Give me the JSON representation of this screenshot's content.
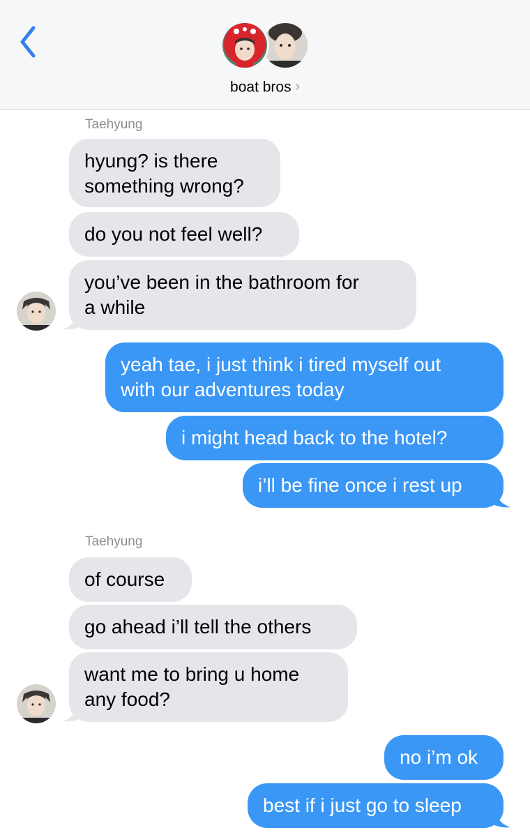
{
  "header": {
    "title": "boat bros",
    "chevron": "›"
  },
  "colors": {
    "sent_bubble": "#3a97f6",
    "received_bubble": "#e5e5ea",
    "ios_blue": "#2f80ed",
    "header_bg": "#f6f7f8"
  },
  "icons": [
    "back-chevron-icon",
    "group-avatar-red-hood",
    "group-avatar-portrait",
    "sender-avatar",
    "title-chevron-icon"
  ],
  "messages": {
    "group1": {
      "sender": "Taehyung",
      "m1_line1": "hyung? is there",
      "m1_line2": "something wrong?",
      "m2": "do you not feel well?",
      "m3_line1": "you’ve been in the bathroom for",
      "m3_line2": "a while"
    },
    "group2": {
      "m1_line1": "yeah tae, i just think i tired myself out",
      "m1_line2": "with our adventures today",
      "m2": "i might head back to the hotel?",
      "m3": "i’ll be fine once i rest up"
    },
    "group3": {
      "sender": "Taehyung",
      "m1": "of course",
      "m2": "go ahead i’ll tell the others",
      "m3_line1": "want me to bring u home",
      "m3_line2": "any food?"
    },
    "group4": {
      "m1": "no i’m ok",
      "m2": "best if i just go to sleep"
    }
  }
}
